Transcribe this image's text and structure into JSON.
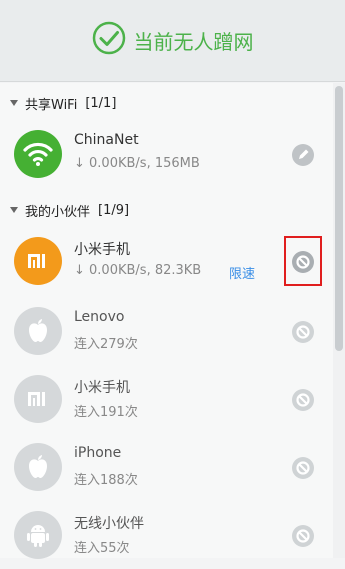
{
  "header": {
    "title": "当前无人蹭网"
  },
  "sections": {
    "shared": {
      "title": "共享WiFi",
      "count": "[1/1]"
    },
    "partners": {
      "title": "我的小伙伴",
      "count": "[1/9]"
    }
  },
  "devices": [
    {
      "name": "ChinaNet",
      "sub": "↓ 0.00KB/s, 156MB",
      "icon": "wifi-icon"
    },
    {
      "name": "小米手机",
      "sub": "↓ 0.00KB/s, 82.3KB",
      "link": "限速",
      "icon": "mi-logo-icon"
    },
    {
      "name": "Lenovo",
      "sub": "连入279次",
      "icon": "apple-icon"
    },
    {
      "name": "小米手机",
      "sub": "连入191次",
      "icon": "mi-logo-icon"
    },
    {
      "name": "iPhone",
      "sub": "连入188次",
      "icon": "apple-icon"
    },
    {
      "name": "无线小伙伴",
      "sub": "连入55次",
      "icon": "android-icon"
    }
  ],
  "colors": {
    "brand_green": "#4cb24a",
    "wifi_green": "#45b033",
    "mi_orange": "#f39a1b",
    "inactive_gray": "#d5d8da",
    "link_blue": "#3a8ee6",
    "highlight_red": "#e01e1e"
  }
}
